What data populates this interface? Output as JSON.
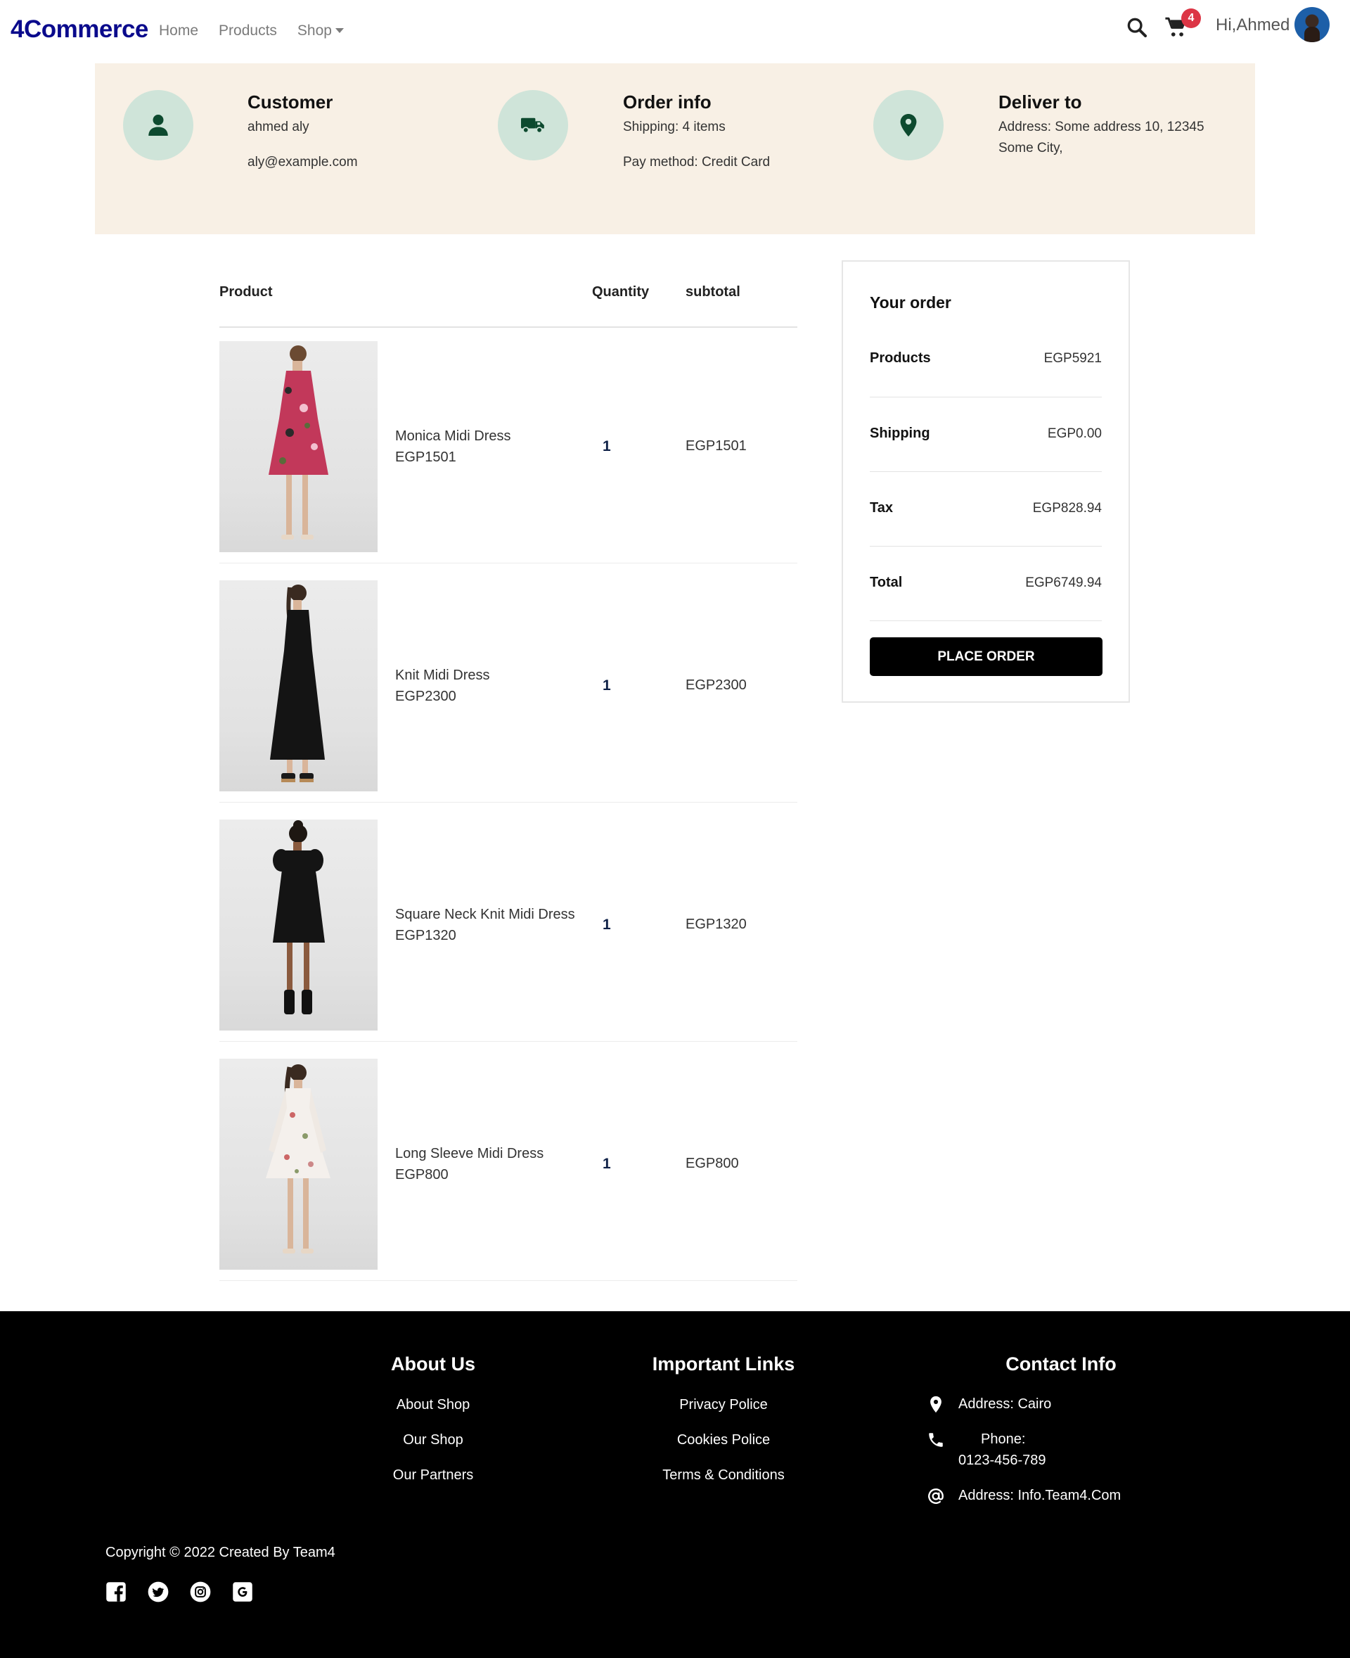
{
  "nav": {
    "brand": "4Commerce",
    "links": [
      "Home",
      "Products",
      "Shop"
    ],
    "cart_count": "4",
    "greeting": "Hi,Ahmed"
  },
  "info": {
    "customer": {
      "title": "Customer",
      "name": "ahmed aly",
      "email": "aly@example.com"
    },
    "order": {
      "title": "Order info",
      "shipping": "Shipping: 4 items",
      "pay": "Pay method: Credit Card"
    },
    "deliver": {
      "title": "Deliver to",
      "line1": "Address: Some address 10, 12345",
      "line2": "Some City,"
    }
  },
  "table": {
    "headers": {
      "product": "Product",
      "quantity": "Quantity",
      "subtotal": "subtotal"
    },
    "rows": [
      {
        "name": "Monica Midi Dress",
        "price": "EGP1501",
        "qty": "1",
        "subtotal": "EGP1501",
        "dress": "floral"
      },
      {
        "name": "Knit Midi Dress",
        "price": "EGP2300",
        "qty": "1",
        "subtotal": "EGP2300",
        "dress": "black-long"
      },
      {
        "name": "Square Neck Knit Midi Dress",
        "price": "EGP1320",
        "qty": "1",
        "subtotal": "EGP1320",
        "dress": "black-short"
      },
      {
        "name": "Long Sleeve Midi Dress",
        "price": "EGP800",
        "qty": "1",
        "subtotal": "EGP800",
        "dress": "white-floral"
      }
    ]
  },
  "summary": {
    "title": "Your order",
    "products_label": "Products",
    "products_value": "EGP5921",
    "shipping_label": "Shipping",
    "shipping_value": "EGP0.00",
    "tax_label": "Tax",
    "tax_value": "EGP828.94",
    "total_label": "Total",
    "total_value": "EGP6749.94",
    "button": "PLACE ORDER"
  },
  "footer": {
    "about": {
      "title": "About Us",
      "links": [
        "About Shop",
        "Our Shop",
        "Our Partners"
      ]
    },
    "important": {
      "title": "Important Links",
      "links": [
        "Privacy Police",
        "Cookies Police",
        "Terms & Conditions"
      ]
    },
    "contact": {
      "title": "Contact Info",
      "address": "Address: Cairo",
      "phone_label": "Phone:",
      "phone": "0123-456-789",
      "email": "Address: Info.Team4.Com"
    },
    "copyright": "Copyright © 2022 Created By Team4",
    "social": [
      "facebook-icon",
      "twitter-icon",
      "instagram-icon",
      "google-icon"
    ]
  },
  "colors": {
    "brand": "#0a0a8c",
    "banner_bg": "#f8f0e5",
    "icon_circle": "#cfe4d9",
    "icon_fg": "#0d4a2f",
    "badge": "#dc3545",
    "footer_bg": "#000000"
  }
}
